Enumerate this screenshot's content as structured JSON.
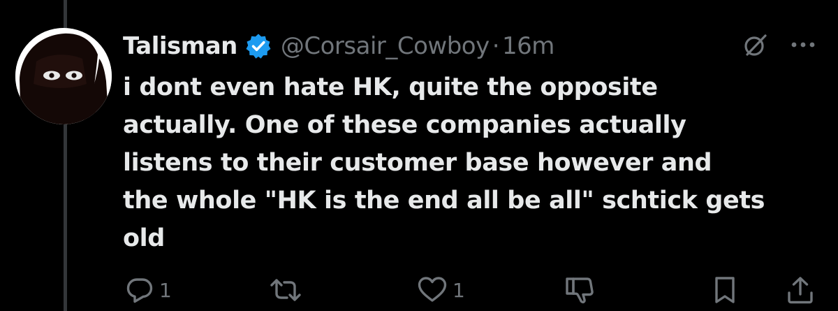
{
  "tweet": {
    "display_name": "Talisman",
    "handle": "@Corsair_Cowboy",
    "separator": "·",
    "time": "16m",
    "text": "i dont even hate HK, quite the opposite\nactually. One of these companies actually\nlistens to their customer base however and\nthe whole \"HK is the end all be all\" schtick gets\nold"
  },
  "actions": {
    "reply_count": "1",
    "retweet_count": "",
    "like_count": "1"
  },
  "colors": {
    "background": "#000000",
    "text_primary": "#e7e9ea",
    "text_secondary": "#71767b",
    "verified": "#1d9bf0",
    "thread_line": "#333639"
  },
  "icons": {
    "verified": "verified-badge-icon",
    "grok": "grok-icon",
    "more": "more-dots-icon",
    "reply": "reply-icon",
    "retweet": "retweet-icon",
    "like": "heart-icon",
    "dislike": "thumbs-down-icon",
    "bookmark": "bookmark-icon",
    "share": "share-icon"
  }
}
